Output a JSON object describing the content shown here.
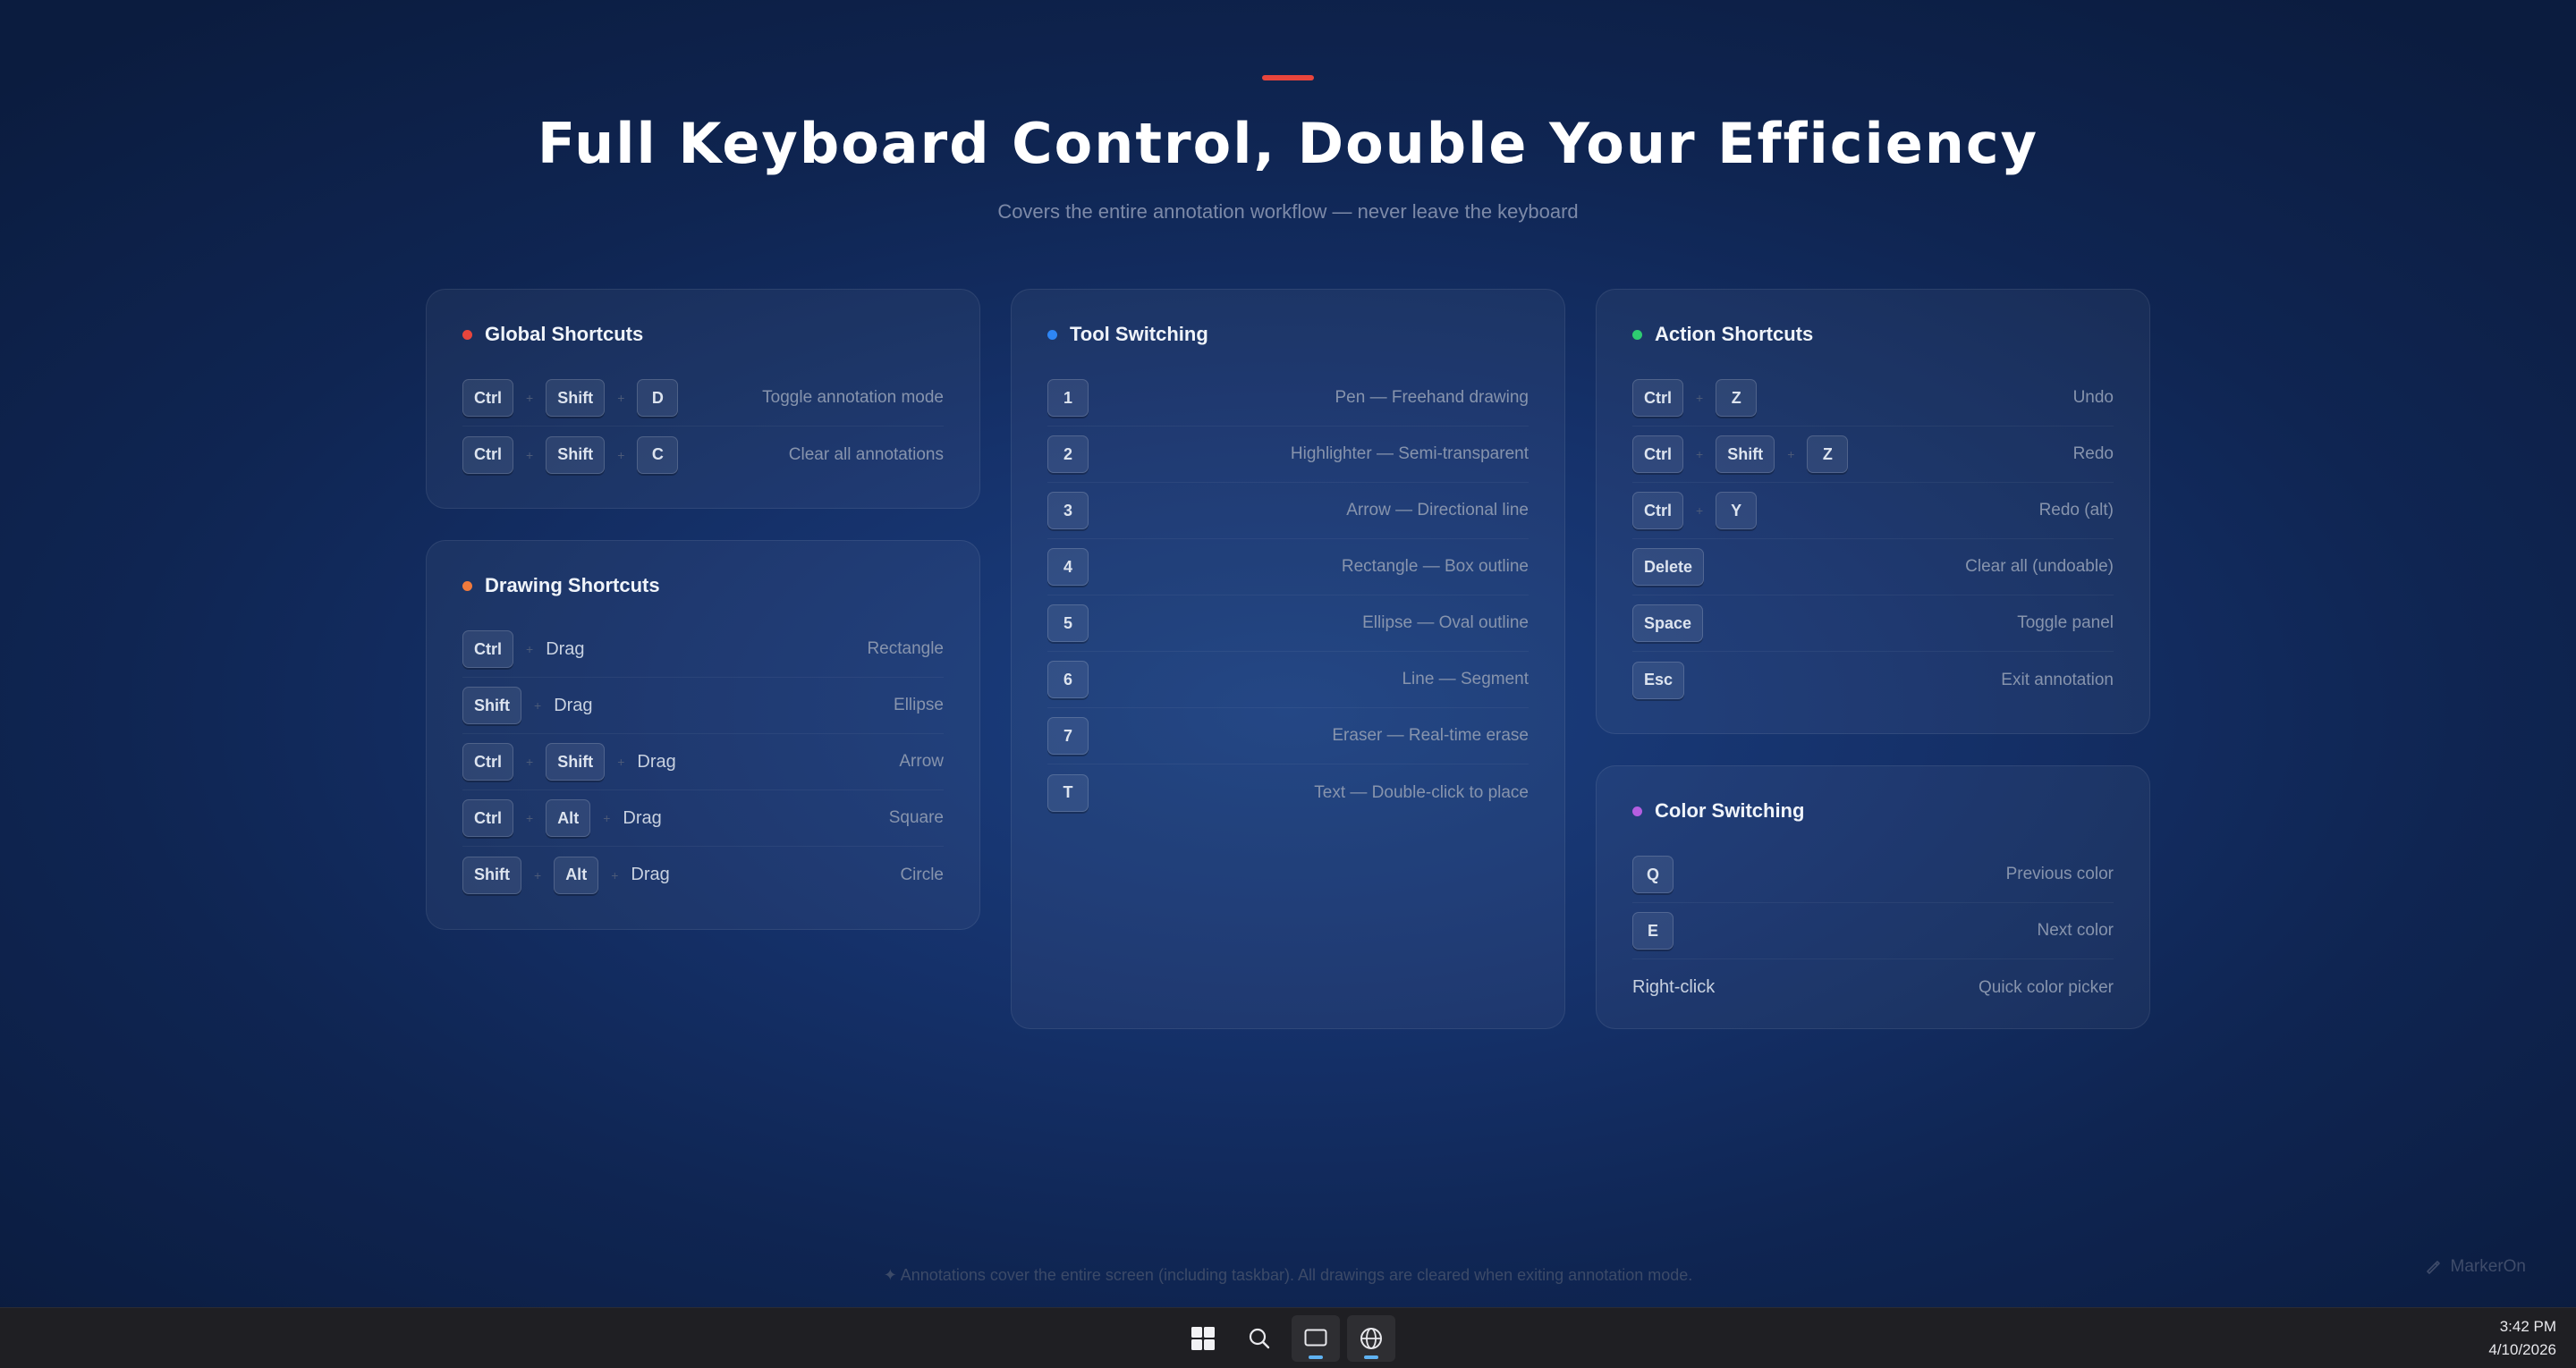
{
  "hero": {
    "title": "Full Keyboard Control, Double Your Efficiency",
    "subtitle": "Covers the entire annotation workflow — never leave the keyboard"
  },
  "cards": {
    "global": {
      "title": "Global Shortcuts",
      "dot_color": "#e8453c",
      "rows": [
        {
          "keys": [
            "Ctrl",
            "Shift",
            "D"
          ],
          "desc": "Toggle annotation mode"
        },
        {
          "keys": [
            "Ctrl",
            "Shift",
            "C"
          ],
          "desc": "Clear all annotations"
        }
      ]
    },
    "drawing": {
      "title": "Drawing Shortcuts",
      "dot_color": "#f07a3c",
      "rows": [
        {
          "keys": [
            "Ctrl"
          ],
          "word": "Drag",
          "desc": "Rectangle"
        },
        {
          "keys": [
            "Shift"
          ],
          "word": "Drag",
          "desc": "Ellipse"
        },
        {
          "keys": [
            "Ctrl",
            "Shift"
          ],
          "word": "Drag",
          "desc": "Arrow"
        },
        {
          "keys": [
            "Ctrl",
            "Alt"
          ],
          "word": "Drag",
          "desc": "Square"
        },
        {
          "keys": [
            "Shift",
            "Alt"
          ],
          "word": "Drag",
          "desc": "Circle"
        }
      ]
    },
    "tools": {
      "title": "Tool Switching",
      "dot_color": "#2e86f5",
      "rows": [
        {
          "keys": [
            "1"
          ],
          "desc": "Pen — Freehand drawing"
        },
        {
          "keys": [
            "2"
          ],
          "desc": "Highlighter — Semi-transparent"
        },
        {
          "keys": [
            "3"
          ],
          "desc": "Arrow — Directional line"
        },
        {
          "keys": [
            "4"
          ],
          "desc": "Rectangle — Box outline"
        },
        {
          "keys": [
            "5"
          ],
          "desc": "Ellipse — Oval outline"
        },
        {
          "keys": [
            "6"
          ],
          "desc": "Line — Segment"
        },
        {
          "keys": [
            "7"
          ],
          "desc": "Eraser — Real-time erase"
        },
        {
          "keys": [
            "T"
          ],
          "desc": "Text — Double-click to place"
        }
      ]
    },
    "actions": {
      "title": "Action Shortcuts",
      "dot_color": "#2ecc71",
      "rows": [
        {
          "keys": [
            "Ctrl",
            "Z"
          ],
          "desc": "Undo"
        },
        {
          "keys": [
            "Ctrl",
            "Shift",
            "Z"
          ],
          "desc": "Redo"
        },
        {
          "keys": [
            "Ctrl",
            "Y"
          ],
          "desc": "Redo (alt)"
        },
        {
          "keys": [
            "Delete"
          ],
          "desc": "Clear all (undoable)"
        },
        {
          "keys": [
            "Space"
          ],
          "desc": "Toggle panel"
        },
        {
          "keys": [
            "Esc"
          ],
          "desc": "Exit annotation"
        }
      ]
    },
    "colors": {
      "title": "Color Switching",
      "dot_color": "#b45ee0",
      "rows": [
        {
          "keys": [
            "Q"
          ],
          "desc": "Previous color"
        },
        {
          "keys": [
            "E"
          ],
          "desc": "Next color"
        },
        {
          "keys": [],
          "word": "Right-click",
          "desc": "Quick color picker"
        }
      ]
    }
  },
  "footer": {
    "note": "✦ Annotations cover the entire screen (including taskbar). All drawings are cleared when exiting annotation mode.",
    "brand": "MarkerOn"
  },
  "taskbar": {
    "icons": [
      "windows-start-icon",
      "search-icon",
      "window-app-icon",
      "globe-icon"
    ],
    "time": "3:42 PM",
    "date": "4/10/2026"
  }
}
